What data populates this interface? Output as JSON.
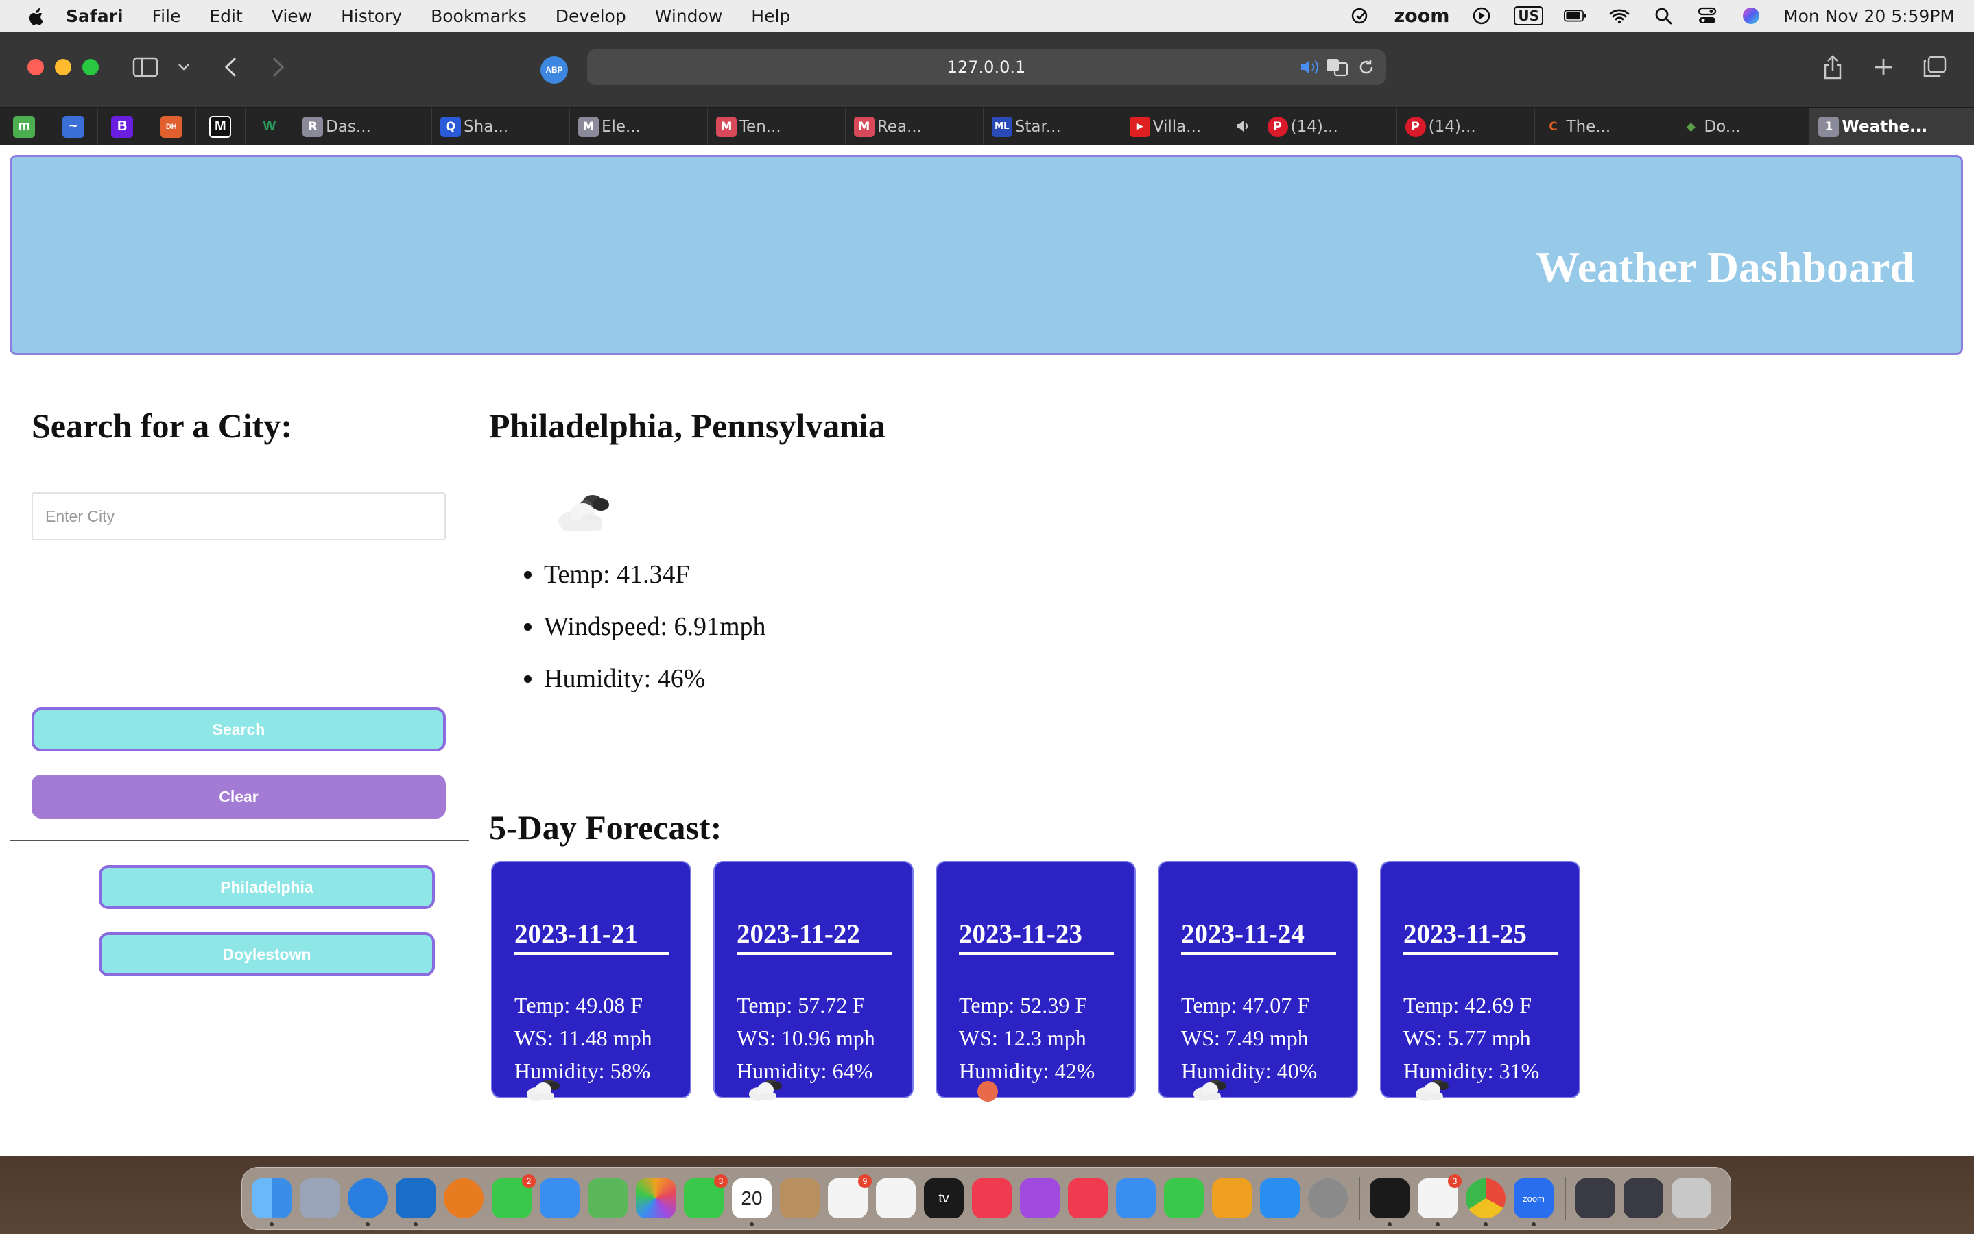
{
  "menubar": {
    "app_name": "Safari",
    "items": [
      "File",
      "Edit",
      "View",
      "History",
      "Bookmarks",
      "Develop",
      "Window",
      "Help"
    ],
    "zoom_label": "zoom",
    "input_source": "US",
    "datetime": "Mon Nov 20  5:59PM"
  },
  "browser": {
    "url": "127.0.0.1",
    "abp_label": "ABP",
    "pinned_tabs": [
      {
        "icon": "m",
        "color": "#4caf50"
      },
      {
        "icon": "~",
        "color": "#3a6fd8"
      },
      {
        "icon": "B",
        "color": "#6a1fe0"
      },
      {
        "icon": "DH",
        "color": "#e06030"
      },
      {
        "icon": "M",
        "color": "#111111"
      },
      {
        "icon": "W",
        "color": "#2a9d5c"
      }
    ],
    "tabs": [
      {
        "label": "Das...",
        "icon": "R",
        "color": "#8a8a9a"
      },
      {
        "label": "Sha...",
        "icon": "Q",
        "color": "#2a5ad8"
      },
      {
        "label": "Ele...",
        "icon": "M",
        "color": "#8a8a9a"
      },
      {
        "label": "Ten...",
        "icon": "M",
        "color": "#d84a5a"
      },
      {
        "label": "Rea...",
        "icon": "M",
        "color": "#d84a5a"
      },
      {
        "label": "Star...",
        "icon": "ML",
        "color": "#2a4ab8"
      },
      {
        "label": "Villa...",
        "icon": "▶",
        "color": "#e02020"
      },
      {
        "label": "(14)...",
        "icon": "P",
        "color": "#d81a2a"
      },
      {
        "label": "(14)...",
        "icon": "P",
        "color": "#d81a2a"
      },
      {
        "label": "The...",
        "icon": "C",
        "color": "#e06020"
      },
      {
        "label": "Do...",
        "icon": "◆",
        "color": "#5aa04a"
      },
      {
        "label": "Weathe...",
        "icon": "1",
        "color": "#8a8a9a"
      }
    ]
  },
  "header": {
    "title": "Weather Dashboard"
  },
  "search": {
    "title": "Search for a City:",
    "placeholder": "Enter City",
    "search_label": "Search",
    "clear_label": "Clear",
    "history": [
      "Philadelphia",
      "Doylestown"
    ]
  },
  "current": {
    "city": "Philadelphia, Pennsylvania",
    "icon": "broken-clouds-icon",
    "temp": "Temp: 41.34F",
    "wind": "Windspeed: 6.91mph",
    "humidity": "Humidity: 46%"
  },
  "forecast": {
    "title": "5-Day Forecast:",
    "days": [
      {
        "date": "2023-11-21",
        "temp": "Temp: 49.08 F",
        "ws": "WS: 11.48 mph",
        "humidity": "Humidity: 58%",
        "icon": "broken-clouds-icon"
      },
      {
        "date": "2023-11-22",
        "temp": "Temp: 57.72 F",
        "ws": "WS: 10.96 mph",
        "humidity": "Humidity: 64%",
        "icon": "broken-clouds-icon"
      },
      {
        "date": "2023-11-23",
        "temp": "Temp: 52.39 F",
        "ws": "WS: 12.3 mph",
        "humidity": "Humidity: 42%",
        "icon": "clear-sun-icon"
      },
      {
        "date": "2023-11-24",
        "temp": "Temp: 47.07 F",
        "ws": "WS: 7.49 mph",
        "humidity": "Humidity: 40%",
        "icon": "broken-clouds-icon"
      },
      {
        "date": "2023-11-25",
        "temp": "Temp: 42.69 F",
        "ws": "WS: 5.77 mph",
        "humidity": "Humidity: 31%",
        "icon": "broken-clouds-icon"
      }
    ]
  },
  "dock": {
    "apps": [
      {
        "name": "finder",
        "color": "#3a8ee8",
        "running": true
      },
      {
        "name": "launchpad",
        "color": "#9aa4b8"
      },
      {
        "name": "safari",
        "color": "#2a7ee0",
        "running": true
      },
      {
        "name": "vscode",
        "color": "#1a6ec8",
        "running": true
      },
      {
        "name": "blender",
        "color": "#e87a20"
      },
      {
        "name": "messages",
        "color": "#3ac84a",
        "badge": "2"
      },
      {
        "name": "mail",
        "color": "#3a8ef0"
      },
      {
        "name": "maps",
        "color": "#5ab85a"
      },
      {
        "name": "photos",
        "color": "#e8b030"
      },
      {
        "name": "facetime",
        "color": "#3ac84a",
        "badge": "3"
      },
      {
        "name": "calendar",
        "color": "#ffffff",
        "label": "20",
        "running": true
      },
      {
        "name": "contacts",
        "color": "#b89060"
      },
      {
        "name": "reminders",
        "color": "#f4f4f4",
        "badge": "9"
      },
      {
        "name": "freeform",
        "color": "#f4f4f4"
      },
      {
        "name": "tv",
        "color": "#1a1a1a",
        "label": "tv"
      },
      {
        "name": "music",
        "color": "#f03a50"
      },
      {
        "name": "podcasts",
        "color": "#a04ae0"
      },
      {
        "name": "news",
        "color": "#f03a50"
      },
      {
        "name": "keynote",
        "color": "#3a8ef0"
      },
      {
        "name": "numbers",
        "color": "#3ac84a"
      },
      {
        "name": "pages",
        "color": "#f0a020"
      },
      {
        "name": "app-store",
        "color": "#2a8ef0"
      },
      {
        "name": "settings",
        "color": "#8a8a8a"
      },
      {
        "name": "terminal",
        "color": "#1a1a1a",
        "running": true
      },
      {
        "name": "slack",
        "color": "#f4f4f4",
        "badge": "3",
        "running": true
      },
      {
        "name": "chrome",
        "color": "#f4f4f4",
        "running": true
      },
      {
        "name": "zoom",
        "color": "#2a6ef0",
        "label": "zoom",
        "running": true
      },
      {
        "name": "window-1",
        "color": "#3a3a44"
      },
      {
        "name": "window-2",
        "color": "#3a3a44"
      },
      {
        "name": "trash",
        "color": "#c8c8c8"
      }
    ]
  }
}
